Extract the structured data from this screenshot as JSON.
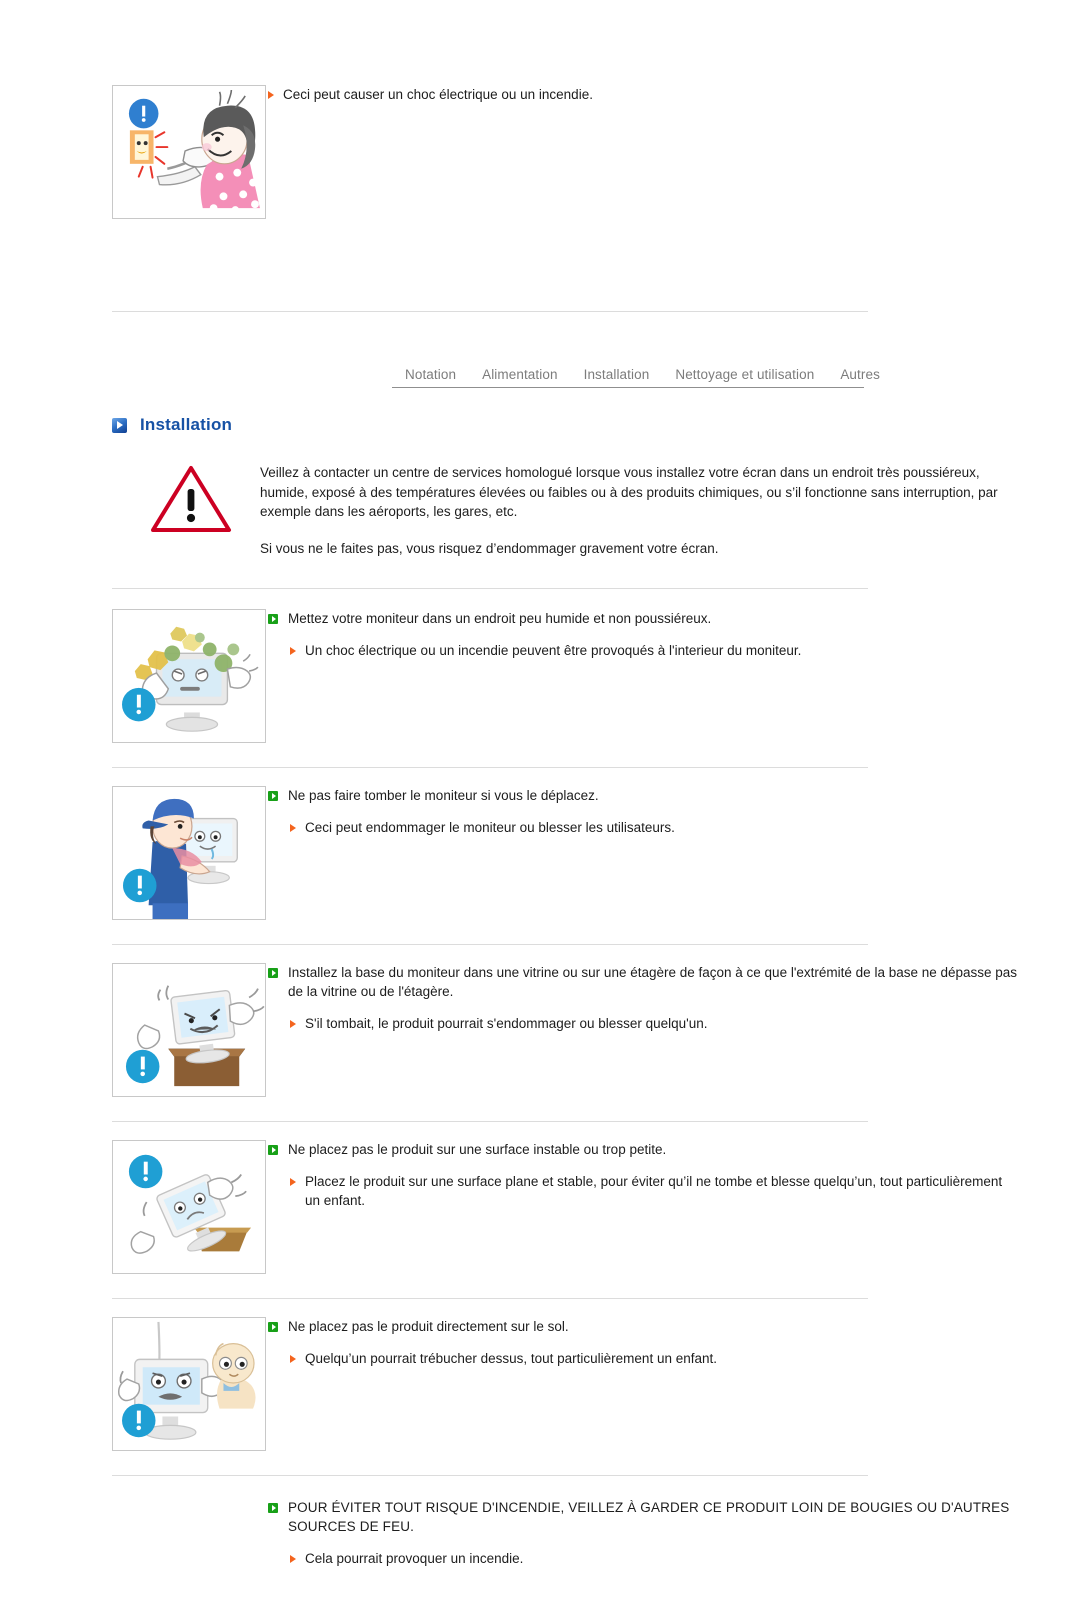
{
  "top_note": {
    "bullet_text": "Ceci peut causer un choc électrique ou un incendie.",
    "illustration_name": "woman-unplugging-sparking-outlet"
  },
  "tabs": [
    {
      "label": "Notation"
    },
    {
      "label": "Alimentation"
    },
    {
      "label": "Installation"
    },
    {
      "label": "Nettoyage et utilisation"
    },
    {
      "label": "Autres"
    }
  ],
  "section": {
    "title": "Installation",
    "icon": "blue-arrow-icon"
  },
  "warning": {
    "icon": "warning-triangle-icon",
    "paragraph_1": "Veillez à contacter un centre de services homologué lorsque vous installez votre écran dans un endroit très poussiéreux, humide, exposé à des températures élevées ou faibles ou à des produits chimiques, ou s’il fonctionne sans interruption, par exemple dans les aéroports, les gares, etc.",
    "paragraph_2": "Si vous ne le faites pas, vous risquez d’endommager gravement votre écran."
  },
  "items": [
    {
      "illustration_name": "monitor-with-dust-particles",
      "main": "Mettez votre moniteur dans un endroit peu humide et non poussiéreux.",
      "sub": "Un choc électrique ou un incendie peuvent être provoqués à l'interieur du moniteur."
    },
    {
      "illustration_name": "person-carrying-monitor",
      "main": "Ne pas faire tomber le moniteur si vous le déplacez.",
      "sub": "Ceci peut endommager le moniteur ou blesser les utilisateurs."
    },
    {
      "illustration_name": "monitor-on-edge-of-shelf",
      "main": "Installez la base du moniteur dans une vitrine ou sur une étagère de façon à ce que l'extrémité de la base ne dépasse pas de la vitrine ou de l'étagère.",
      "sub": "S'il tombait, le produit pourrait s'endommager ou blesser quelqu'un."
    },
    {
      "illustration_name": "monitor-tipping-off-small-surface",
      "main": "Ne placez pas le produit sur une surface instable ou trop petite.",
      "sub": "Placez le produit sur une surface plane et stable, pour éviter qu’il ne tombe et blesse quelqu’un, tout particulièrement un enfant."
    },
    {
      "illustration_name": "monitor-on-floor-with-child",
      "main": "Ne placez pas le produit directement sur le sol.",
      "sub": "Quelqu’un pourrait trébucher dessus, tout particulièrement un enfant."
    }
  ],
  "footer_note": {
    "main": "POUR ÉVITER TOUT RISQUE D'INCENDIE, VEILLEZ À GARDER CE PRODUIT LOIN DE BOUGIES OU D'AUTRES SOURCES DE FEU.",
    "sub": "Cela pourrait provoquer un incendie."
  },
  "colors": {
    "heading_blue": "#1752a5",
    "green_bullet": "#18a018",
    "orange_bullet": "#f4641e",
    "warning_red": "#cc0022",
    "info_blue": "#1f9fd4",
    "tab_gray": "#7c7c7c"
  }
}
